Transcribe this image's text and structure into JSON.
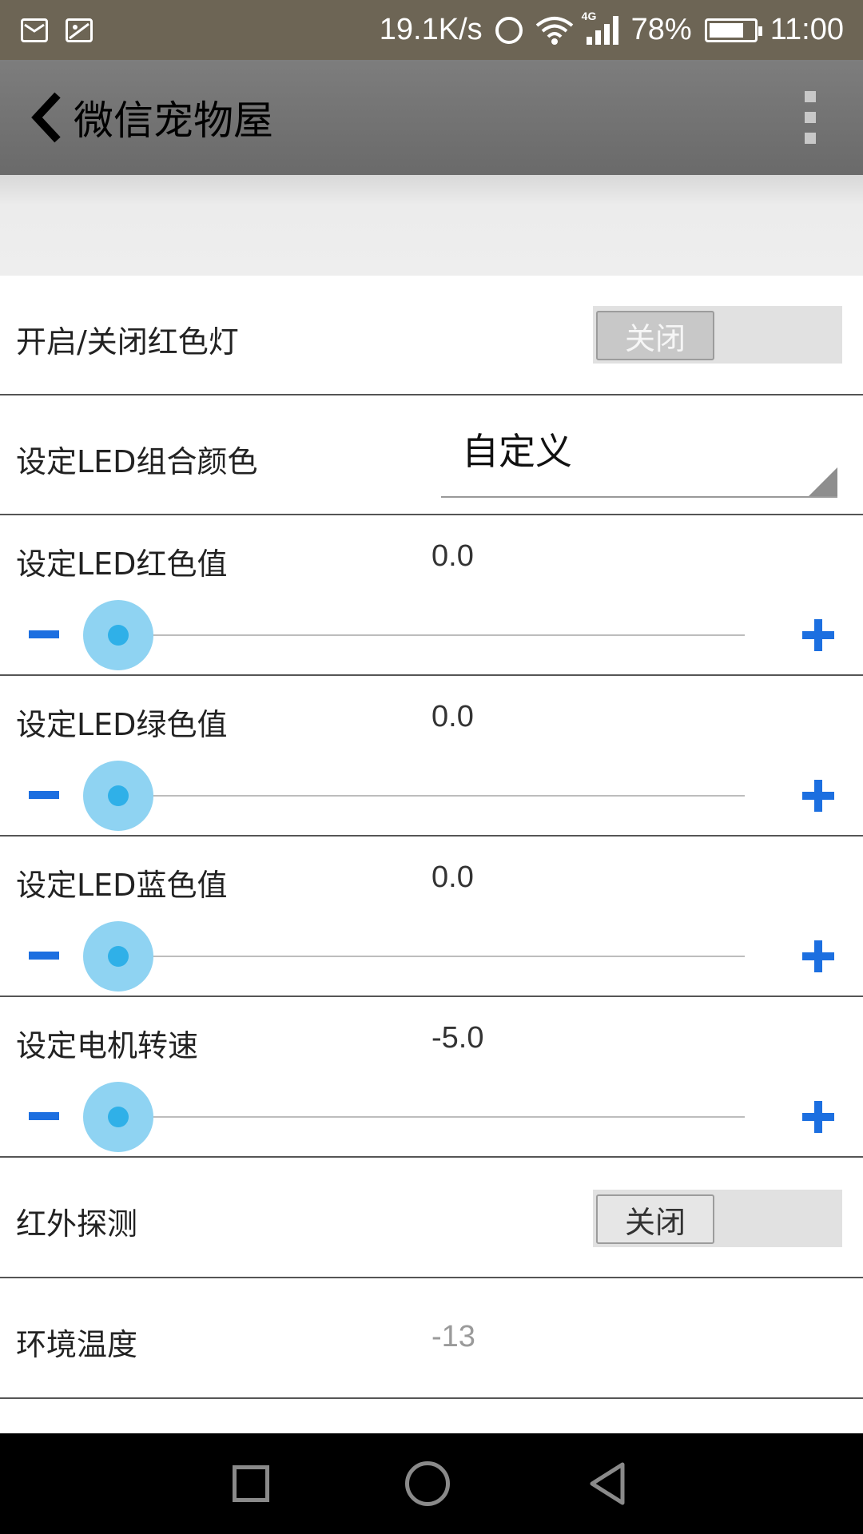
{
  "status_bar": {
    "speed": "19.1K/s",
    "network_tag": "4G",
    "battery": "78%",
    "time": "11:00"
  },
  "appbar": {
    "title": "微信宠物屋"
  },
  "rows": {
    "red_light": {
      "label": "开启/关闭红色灯",
      "toggle": "关闭"
    },
    "led_combo": {
      "label": "设定LED组合颜色",
      "value": "自定义"
    },
    "led_red": {
      "label": "设定LED红色值",
      "value": "0.0",
      "fraction": 0.0
    },
    "led_green": {
      "label": "设定LED绿色值",
      "value": "0.0",
      "fraction": 0.0
    },
    "led_blue": {
      "label": "设定LED蓝色值",
      "value": "0.0",
      "fraction": 0.0
    },
    "motor": {
      "label": "设定电机转速",
      "value": "-5.0",
      "fraction": 0.0
    },
    "infrared": {
      "label": "红外探测",
      "toggle": "关闭"
    },
    "temperature": {
      "label": "环境温度",
      "value": "-13"
    }
  },
  "colors": {
    "accent_blue": "#1c6fe0",
    "thumb": "#8fd3f2",
    "appbar": "#737373"
  }
}
